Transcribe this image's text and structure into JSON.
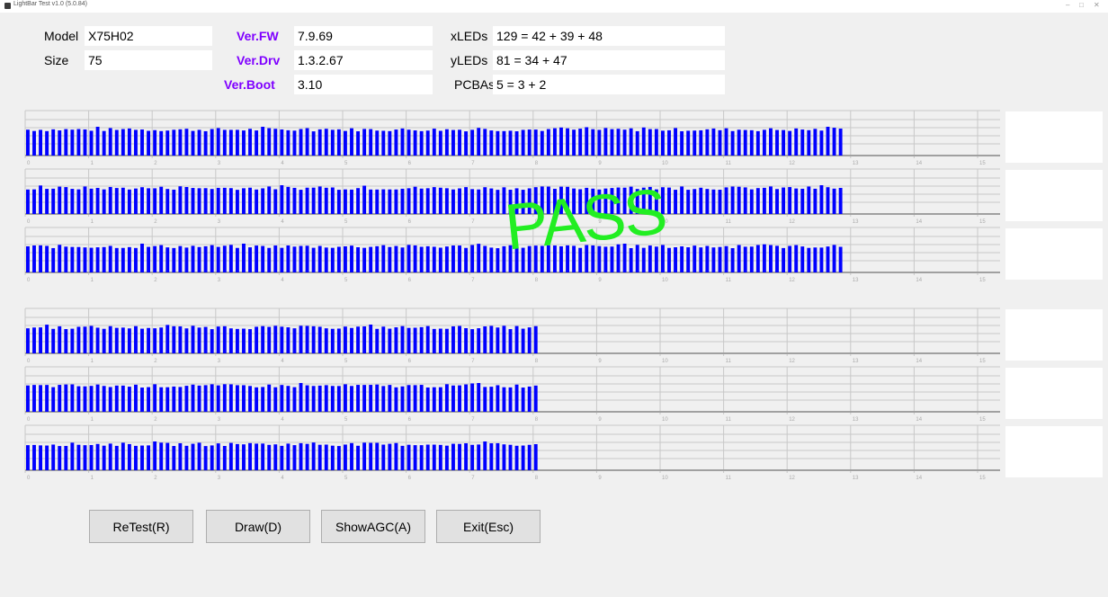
{
  "window": {
    "title": "LightBar Test v1.0 (5.0.84)"
  },
  "info": {
    "model_label": "Model",
    "model_value": "X75H02",
    "size_label": "Size",
    "size_value": "75",
    "fw_label": "Ver.FW",
    "fw_value": "7.9.69",
    "drv_label": "Ver.Drv",
    "drv_value": "1.3.2.67",
    "boot_label": "Ver.Boot",
    "boot_value": "3.10",
    "xleds_label": "xLEDs",
    "xleds_value": "129 = 42 + 39 + 48",
    "yleds_label": "yLEDs",
    "yleds_value": "81 = 34 + 47",
    "pcbas_label": "PCBAs",
    "pcbas_value": "5 = 3  + 2"
  },
  "result": {
    "text": "PASS",
    "color": "#22ee22"
  },
  "colors": {
    "bar": "#0000ff",
    "grid": "#c8c8c8",
    "axis": "#a0a0a0",
    "version_label": "#7f00ff"
  },
  "charts": {
    "tick_labels": [
      "0",
      "1",
      "2",
      "3",
      "4",
      "5",
      "6",
      "7",
      "8",
      "9",
      "10",
      "11",
      "12",
      "13",
      "14",
      "15"
    ],
    "panels": [
      {
        "group": "x",
        "bar_count": 129,
        "level": 0.9
      },
      {
        "group": "x",
        "bar_count": 129,
        "level": 0.9
      },
      {
        "group": "x",
        "bar_count": 129,
        "level": 0.9
      },
      {
        "group": "y",
        "bar_count": 81,
        "level": 0.9
      },
      {
        "group": "y",
        "bar_count": 81,
        "level": 0.9
      },
      {
        "group": "y",
        "bar_count": 81,
        "level": 0.9
      }
    ]
  },
  "buttons": {
    "retest": "ReTest(R)",
    "draw": "Draw(D)",
    "showagc": "ShowAGC(A)",
    "exit": "Exit(Esc)"
  }
}
